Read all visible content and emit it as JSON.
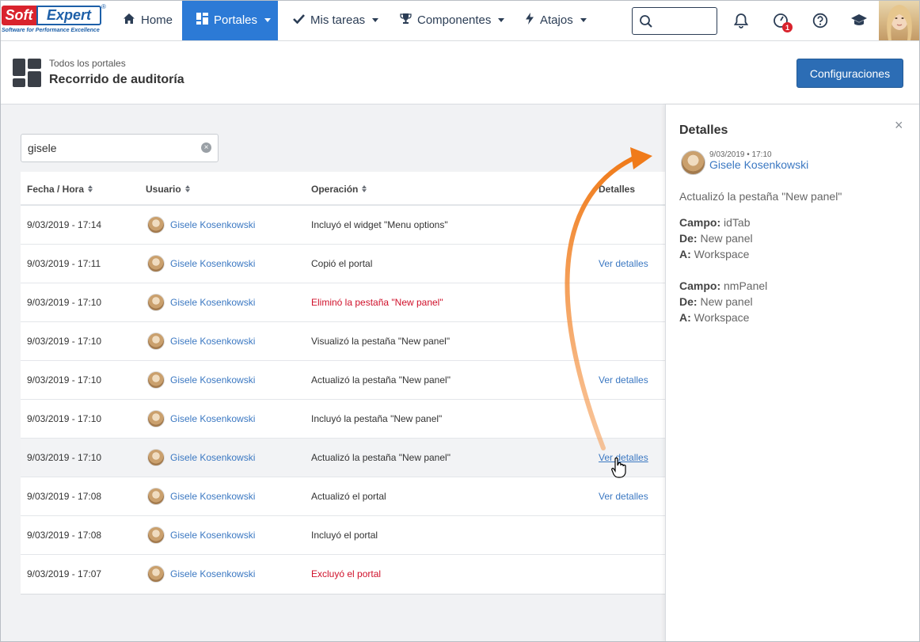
{
  "brand": {
    "soft": "Soft",
    "expert": "Expert",
    "reg": "®",
    "tagline": "Software for Performance Excellence"
  },
  "nav": {
    "home": "Home",
    "portales": "Portales",
    "mis_tareas": "Mis tareas",
    "componentes": "Componentes",
    "atajos": "Atajos",
    "notification_badge": "1"
  },
  "header": {
    "breadcrumb": "Todos los portales",
    "title": "Recorrido de auditoría",
    "config_button": "Configuraciones"
  },
  "filter": {
    "value": "gisele",
    "clear": "×"
  },
  "table": {
    "columns": {
      "fecha": "Fecha / Hora",
      "usuario": "Usuario",
      "operacion": "Operación",
      "detalles": "Detalles"
    },
    "rows": [
      {
        "fecha": "9/03/2019 - 17:14",
        "usuario": "Gisele Kosenkowski",
        "operacion": "Incluyó el widget \"Menu options\"",
        "detalles": ""
      },
      {
        "fecha": "9/03/2019 - 17:11",
        "usuario": "Gisele Kosenkowski",
        "operacion": "Copió el portal",
        "detalles": "Ver detalles"
      },
      {
        "fecha": "9/03/2019 - 17:10",
        "usuario": "Gisele Kosenkowski",
        "operacion": "Eliminó la pestaña \"New panel\"",
        "detalles": ""
      },
      {
        "fecha": "9/03/2019 - 17:10",
        "usuario": "Gisele Kosenkowski",
        "operacion": "Visualizó la pestaña \"New panel\"",
        "detalles": ""
      },
      {
        "fecha": "9/03/2019 - 17:10",
        "usuario": "Gisele Kosenkowski",
        "operacion": "Actualizó la pestaña \"New panel\"",
        "detalles": "Ver detalles"
      },
      {
        "fecha": "9/03/2019 - 17:10",
        "usuario": "Gisele Kosenkowski",
        "operacion": "Incluyó la pestaña \"New panel\"",
        "detalles": ""
      },
      {
        "fecha": "9/03/2019 - 17:10",
        "usuario": "Gisele Kosenkowski",
        "operacion": "Actualizó la pestaña \"New panel\"",
        "detalles": "Ver detalles"
      },
      {
        "fecha": "9/03/2019 - 17:08",
        "usuario": "Gisele Kosenkowski",
        "operacion": "Actualizó el portal",
        "detalles": "Ver detalles"
      },
      {
        "fecha": "9/03/2019 - 17:08",
        "usuario": "Gisele Kosenkowski",
        "operacion": "Incluyó el portal",
        "detalles": ""
      },
      {
        "fecha": "9/03/2019 - 17:07",
        "usuario": "Gisele Kosenkowski",
        "operacion": "Excluyó el portal",
        "detalles": ""
      }
    ]
  },
  "panel": {
    "title": "Detalles",
    "close": "×",
    "meta": "9/03/2019 • 17:10",
    "user": "Gisele Kosenkowski",
    "action": "Actualizó la pestaña \"New panel\"",
    "labels": {
      "campo": "Campo:",
      "de": "De:",
      "a": "A:"
    },
    "changes": [
      {
        "campo": "idTab",
        "de": "New panel",
        "a": "Workspace"
      },
      {
        "campo": "nmPanel",
        "de": "New panel",
        "a": "Workspace"
      }
    ]
  },
  "colors": {
    "accent": "#2c7ad6",
    "link": "#3b78c2",
    "danger": "#d0112b",
    "arrow": "#f07b1a"
  }
}
